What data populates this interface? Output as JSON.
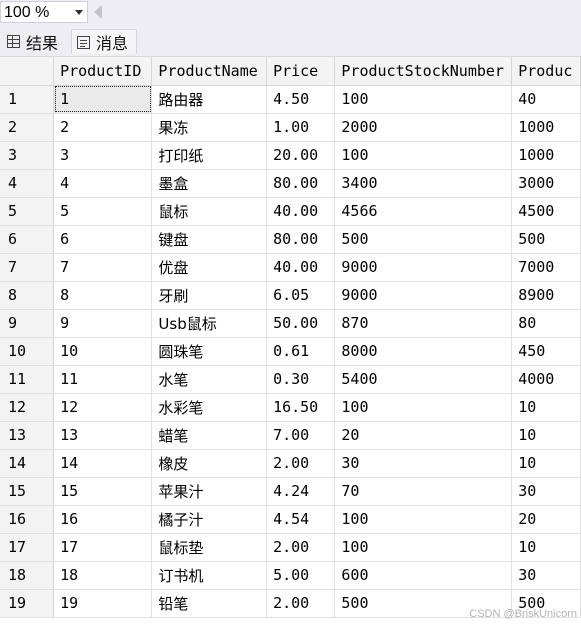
{
  "toolbar": {
    "zoom": "100 %"
  },
  "tabs": {
    "results": "结果",
    "messages": "消息"
  },
  "grid": {
    "columns": [
      "ProductID",
      "ProductName",
      "Price",
      "ProductStockNumber",
      "Produc"
    ],
    "rows": [
      {
        "n": "1",
        "id": "1",
        "name": "路由器",
        "price": "4.50",
        "stock": "100",
        "sold": "40"
      },
      {
        "n": "2",
        "id": "2",
        "name": "果冻",
        "price": "1.00",
        "stock": "2000",
        "sold": "1000"
      },
      {
        "n": "3",
        "id": "3",
        "name": "打印纸",
        "price": "20.00",
        "stock": "100",
        "sold": "1000"
      },
      {
        "n": "4",
        "id": "4",
        "name": "墨盒",
        "price": "80.00",
        "stock": "3400",
        "sold": "3000"
      },
      {
        "n": "5",
        "id": "5",
        "name": "鼠标",
        "price": "40.00",
        "stock": "4566",
        "sold": "4500"
      },
      {
        "n": "6",
        "id": "6",
        "name": "键盘",
        "price": "80.00",
        "stock": "500",
        "sold": "500"
      },
      {
        "n": "7",
        "id": "7",
        "name": "优盘",
        "price": "40.00",
        "stock": "9000",
        "sold": "7000"
      },
      {
        "n": "8",
        "id": "8",
        "name": "牙刷",
        "price": "6.05",
        "stock": "9000",
        "sold": "8900"
      },
      {
        "n": "9",
        "id": "9",
        "name": "Usb鼠标",
        "price": "50.00",
        "stock": "870",
        "sold": "80"
      },
      {
        "n": "10",
        "id": "10",
        "name": "圆珠笔",
        "price": "0.61",
        "stock": "8000",
        "sold": "450"
      },
      {
        "n": "11",
        "id": "11",
        "name": "水笔",
        "price": "0.30",
        "stock": "5400",
        "sold": "4000"
      },
      {
        "n": "12",
        "id": "12",
        "name": "水彩笔",
        "price": "16.50",
        "stock": "100",
        "sold": "10"
      },
      {
        "n": "13",
        "id": "13",
        "name": "蜡笔",
        "price": "7.00",
        "stock": "20",
        "sold": "10"
      },
      {
        "n": "14",
        "id": "14",
        "name": "橡皮",
        "price": "2.00",
        "stock": "30",
        "sold": "10"
      },
      {
        "n": "15",
        "id": "15",
        "name": "苹果汁",
        "price": "4.24",
        "stock": "70",
        "sold": "30"
      },
      {
        "n": "16",
        "id": "16",
        "name": "橘子汁",
        "price": "4.54",
        "stock": "100",
        "sold": "20"
      },
      {
        "n": "17",
        "id": "17",
        "name": "鼠标垫",
        "price": "2.00",
        "stock": "100",
        "sold": "10"
      },
      {
        "n": "18",
        "id": "18",
        "name": "订书机",
        "price": "5.00",
        "stock": "600",
        "sold": "30"
      },
      {
        "n": "19",
        "id": "19",
        "name": "铅笔",
        "price": "2.00",
        "stock": "500",
        "sold": "500"
      }
    ]
  },
  "watermark": "CSDN @BriskUnicorn"
}
